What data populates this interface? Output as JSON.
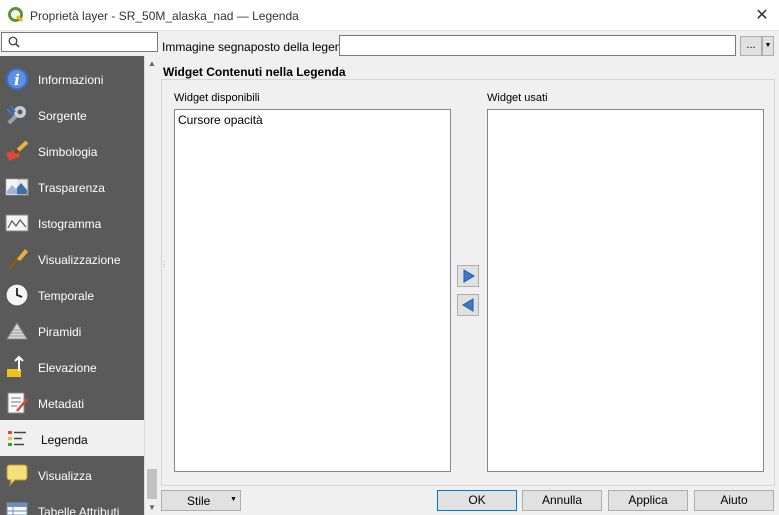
{
  "window": {
    "title": "Proprietà layer - SR_50M_alaska_nad — Legenda",
    "close_symbol": "✕",
    "app_icon": "qgis-icon"
  },
  "sidebar": {
    "search_placeholder": "",
    "items": [
      {
        "label": "Informazioni",
        "icon": "information-icon"
      },
      {
        "label": "Sorgente",
        "icon": "source-icon"
      },
      {
        "label": "Simbologia",
        "icon": "symbology-icon"
      },
      {
        "label": "Trasparenza",
        "icon": "transparency-icon"
      },
      {
        "label": "Istogramma",
        "icon": "histogram-icon"
      },
      {
        "label": "Visualizzazione",
        "icon": "rendering-icon"
      },
      {
        "label": "Temporale",
        "icon": "temporal-icon"
      },
      {
        "label": "Piramidi",
        "icon": "pyramids-icon"
      },
      {
        "label": "Elevazione",
        "icon": "elevation-icon"
      },
      {
        "label": "Metadati",
        "icon": "metadata-icon"
      },
      {
        "label": "Legenda",
        "icon": "legend-icon",
        "active": true
      },
      {
        "label": "Visualizza",
        "icon": "display-icon"
      },
      {
        "label": "Tabelle Attributi",
        "icon": "attribute-tables-icon"
      }
    ]
  },
  "legend": {
    "placeholder_label": "Immagine segnaposto della legenda",
    "placeholder_value": "",
    "browse_label": "...",
    "group_title": "Widget Contenuti nella Legenda",
    "available_label": "Widget disponibili",
    "available_items": [
      "Cursore opacità"
    ],
    "used_label": "Widget usati",
    "used_items": []
  },
  "footer": {
    "style_label": "Stile",
    "ok_label": "OK",
    "cancel_label": "Annulla",
    "apply_label": "Applica",
    "help_label": "Aiuto"
  },
  "colors": {
    "sidebar_bg": "#5a5a5a",
    "accent": "#0078d7",
    "qgis_green": "#589632",
    "arrow_blue": "#3b7ac7"
  }
}
